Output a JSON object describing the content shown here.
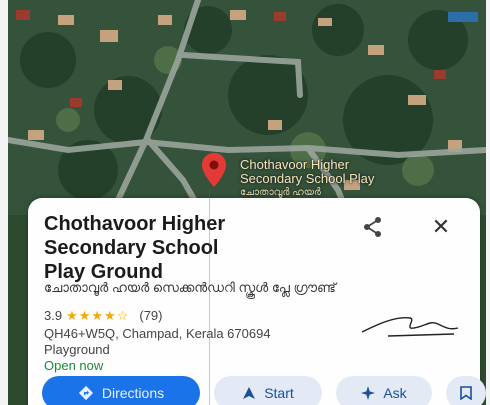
{
  "map": {
    "pin_label_line1": "Chothavoor Higher",
    "pin_label_line2": "Secondary School Play",
    "pin_label_line3": "ചോതാവൂർ ഹയർ"
  },
  "place": {
    "title_line1": "Chothavoor Higher",
    "title_line2": "Secondary School",
    "title_line3": "Play Ground",
    "name_ml": "ചോതാവൂർ ഹയർ സെക്കൻഡറി സ്കൂൾ പ്ലേ ഗ്രൗണ്ട്",
    "rating": "3.9",
    "stars": "★★★★☆",
    "review_count": "(79)",
    "address": "QH46+W5Q, Champad, Kerala 670694",
    "category": "Playground",
    "hours_status": "Open now"
  },
  "actions": {
    "directions_label": "Directions",
    "start_label": "Start",
    "ask_label": "Ask"
  },
  "colors": {
    "primary": "#1a73e8",
    "chip_bg": "#e3eaf6",
    "open_green": "#1a8a3a",
    "star": "#f2a900",
    "pin": "#e53935"
  },
  "icons": [
    "share-icon",
    "close-icon",
    "directions-icon",
    "navigation-arrow-icon",
    "sparkle-icon",
    "bookmark-icon",
    "map-pin-icon"
  ]
}
